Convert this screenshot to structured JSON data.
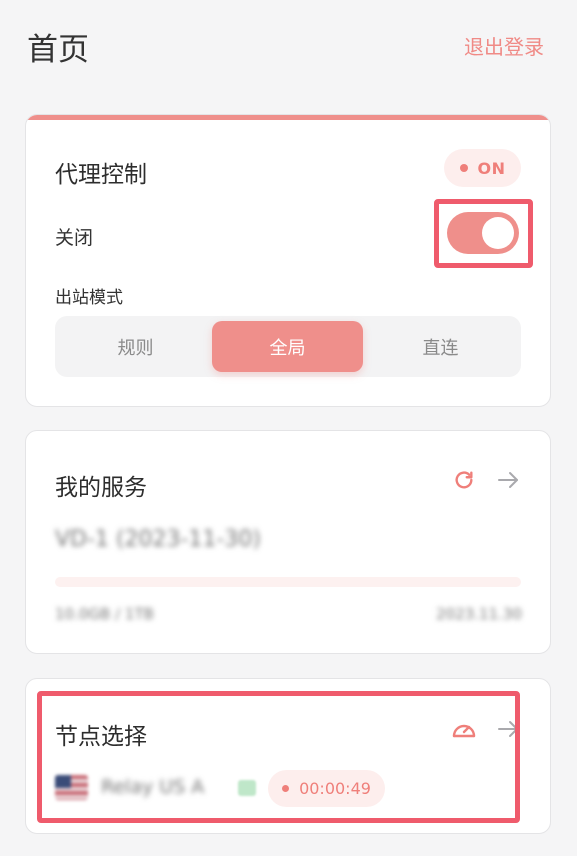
{
  "header": {
    "title": "首页",
    "logout_label": "退出登录"
  },
  "proxy_control": {
    "title": "代理控制",
    "status_badge": "ON",
    "toggle_state_label": "关闭",
    "toggle_on": true,
    "mode_label": "出站模式",
    "modes": [
      "规则",
      "全局",
      "直连"
    ],
    "selected_mode": "全局"
  },
  "service": {
    "title": "我的服务",
    "refresh_icon": "refresh-icon",
    "arrow_icon": "arrow-right-icon",
    "plan_name": "VD-1 (2023-11-30)",
    "usage_text": "10.0GB / 1TB",
    "expiry_text": "2023.11.30",
    "usage_progress": 0.0
  },
  "node": {
    "title": "节点选择",
    "speed_icon": "speedometer-icon",
    "arrow_icon": "arrow-right-icon",
    "flag_icon": "us-flag-icon",
    "node_name": "Relay US A",
    "timer": "00:00:49"
  },
  "colors": {
    "accent": "#ef8f8b",
    "accent_text": "#ef7f7a",
    "highlight": "#ef5b6c",
    "background": "#f5f5f6"
  }
}
